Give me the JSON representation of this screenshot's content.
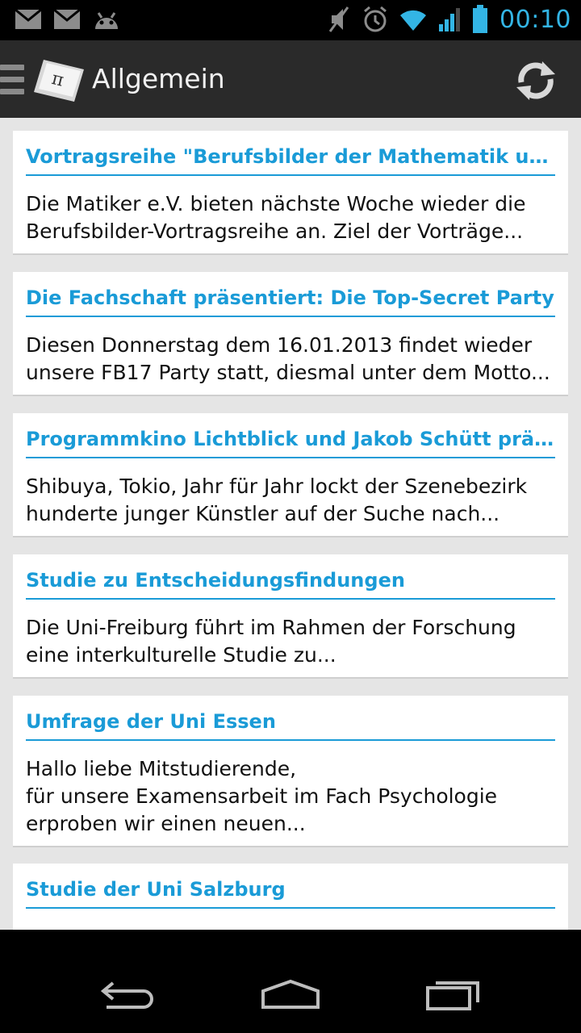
{
  "status_bar": {
    "time": "00:10",
    "left_icons": [
      "mail-icon",
      "mail-icon",
      "android-debug-icon"
    ],
    "right_icons": [
      "mute-icon",
      "alarm-icon",
      "wifi-icon",
      "signal-icon",
      "battery-icon"
    ]
  },
  "action_bar": {
    "title": "Allgemein",
    "logo_symbol": "π",
    "refresh_icon": "refresh-icon",
    "drawer_icon": "drawer-icon"
  },
  "colors": {
    "accent": "#1a9bd7",
    "actionbar_bg": "#2a2a2a",
    "content_bg": "#e5e5e5",
    "card_bg": "#ffffff",
    "statusbar_accent": "#33b5e5"
  },
  "articles": [
    {
      "title": "Vortragsreihe \"Berufsbilder der Mathematik und In...",
      "excerpt": "Die Matiker e.V. bieten nächste Woche wieder die\nBerufsbilder-Vortragsreihe an. Ziel der Vorträge..."
    },
    {
      "title": "Die Fachschaft präsentiert: Die Top-Secret Party",
      "excerpt": "Diesen Donnerstag dem 16.01.2013 findet wieder\nunsere FB17 Party statt, diesmal unter dem Motto..."
    },
    {
      "title": "Programmkino Lichtblick und Jakob Schütt präse...",
      "excerpt": "Shibuya, Tokio, Jahr für Jahr lockt der Szenebezirk\nhunderte junger Künstler auf der Suche nach..."
    },
    {
      "title": "Studie zu Entscheidungsfindungen",
      "excerpt": "Die Uni-Freiburg führt im Rahmen der Forschung\neine interkulturelle Studie zu..."
    },
    {
      "title": "Umfrage der Uni Essen",
      "excerpt": "Hallo liebe Mitstudierende,\nfür unsere Examensarbeit im Fach Psychologie\nerproben wir einen neuen..."
    },
    {
      "title": "Studie der Uni Salzburg",
      "excerpt": ""
    }
  ],
  "nav_bar": {
    "back_icon": "back-icon",
    "home_icon": "home-icon",
    "recents_icon": "recent-apps-icon"
  }
}
